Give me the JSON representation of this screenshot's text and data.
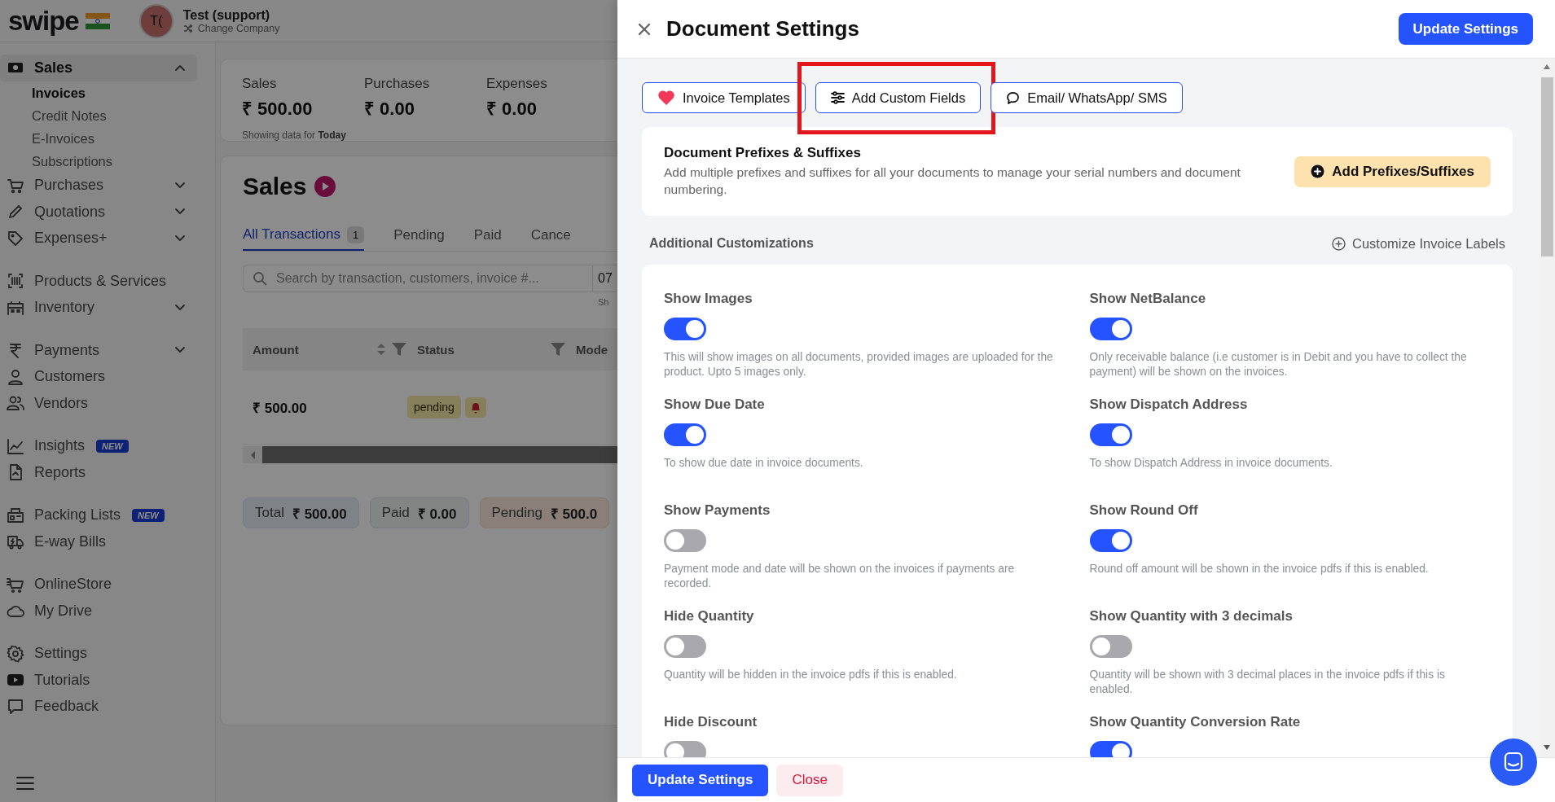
{
  "header": {
    "logo": "swipe",
    "avatar": "T(",
    "company": "Test (support)",
    "switch_label": "Change Company"
  },
  "sidebar": {
    "groups": [
      {
        "items": [
          {
            "label": "Sales",
            "expanded": true,
            "selected": true,
            "children": [
              {
                "label": "Invoices",
                "selected": true
              },
              {
                "label": "Credit Notes",
                "selected": false
              },
              {
                "label": "E-Invoices",
                "selected": false
              },
              {
                "label": "Subscriptions",
                "selected": false
              }
            ]
          },
          {
            "label": "Purchases",
            "expanded": false,
            "selected": false
          },
          {
            "label": "Quotations",
            "expanded": false,
            "selected": false
          },
          {
            "label": "Expenses+",
            "expanded": false,
            "selected": false
          }
        ]
      },
      {
        "items": [
          {
            "label": "Products & Services",
            "selected": false
          },
          {
            "label": "Inventory",
            "expanded": false,
            "selected": false
          }
        ]
      },
      {
        "items": [
          {
            "label": "Payments",
            "expanded": false,
            "selected": false
          },
          {
            "label": "Customers",
            "selected": false
          },
          {
            "label": "Vendors",
            "selected": false
          }
        ]
      },
      {
        "items": [
          {
            "label": "Insights",
            "badge": "NEW",
            "selected": false
          },
          {
            "label": "Reports",
            "selected": false
          }
        ]
      },
      {
        "items": [
          {
            "label": "Packing Lists",
            "badge": "NEW",
            "selected": false
          },
          {
            "label": "E-way Bills",
            "selected": false
          }
        ]
      },
      {
        "items": [
          {
            "label": "OnlineStore",
            "selected": false
          },
          {
            "label": "My Drive",
            "selected": false
          }
        ]
      },
      {
        "items": [
          {
            "label": "Settings",
            "selected": false
          },
          {
            "label": "Tutorials",
            "selected": false
          },
          {
            "label": "Feedback",
            "selected": false
          }
        ]
      }
    ]
  },
  "stats": {
    "items": [
      {
        "label": "Sales",
        "value": "₹ 500.00"
      },
      {
        "label": "Purchases",
        "value": "₹ 0.00"
      },
      {
        "label": "Expenses",
        "value": "₹ 0.00"
      }
    ],
    "note": "Showing data for **Today**"
  },
  "sales": {
    "title": "Sales",
    "tabs": [
      {
        "label": "All Transactions",
        "count": "1",
        "selected": true
      },
      {
        "label": "Pending",
        "selected": false
      },
      {
        "label": "Paid",
        "selected": false
      },
      {
        "label": "Cance",
        "selected": false
      }
    ],
    "search": {
      "placeholder": "Search by transaction, customers, invoice #..."
    },
    "date_field": {
      "value": "07"
    },
    "date_note": "Sh",
    "table": {
      "columns": [
        {
          "label": "Amount",
          "sortable": true,
          "filterable": true
        },
        {
          "label": "Status",
          "filterable": true
        },
        {
          "label": "Mode"
        }
      ],
      "rows": [
        {
          "amount": "₹ 500.00",
          "status": "pending"
        }
      ]
    },
    "totals": [
      {
        "label": "Total",
        "value": "₹ 500.00",
        "kind": "total"
      },
      {
        "label": "Paid",
        "value": "₹ 0.00",
        "kind": "paid"
      },
      {
        "label": "Pending",
        "value": "₹ 500.0",
        "kind": "pending"
      }
    ]
  },
  "drawer": {
    "title": "Document Settings",
    "primary_action": "Update Settings",
    "tabs": [
      {
        "label": "Invoice Templates",
        "kind": "templates"
      },
      {
        "label": "Add Custom Fields",
        "kind": "fields",
        "highlighted": true
      },
      {
        "label": "Email/ WhatsApp/ SMS",
        "kind": "messages"
      }
    ],
    "prefixes": {
      "title": "Document Prefixes & Suffixes",
      "description": "Add multiple prefixes and suffixes for all your documents to manage your serial numbers and document numbering.",
      "action": "Add Prefixes/Suffixes"
    },
    "section": {
      "title": "Additional Customizations",
      "link": "Customize Invoice Labels"
    },
    "settings": [
      {
        "label": "Show Images",
        "on": true,
        "description": "This will show images on all documents, provided images are uploaded for the product. Upto 5 images only."
      },
      {
        "label": "Show NetBalance",
        "on": true,
        "description": "Only receivable balance (i.e customer is in Debit and you have to collect the payment) will be shown on the invoices."
      },
      {
        "label": "Show Due Date",
        "on": true,
        "description": "To show due date in invoice documents."
      },
      {
        "label": "Show Dispatch Address",
        "on": true,
        "description": "To show Dispatch Address in invoice documents."
      },
      {
        "label": "Show Payments",
        "on": false,
        "description": "Payment mode and date will be shown on the invoices if payments are recorded."
      },
      {
        "label": "Show Round Off",
        "on": true,
        "description": "Round off amount will be shown in the invoice pdfs if this is enabled."
      },
      {
        "label": "Hide Quantity",
        "on": false,
        "description": "Quantity will be hidden in the invoice pdfs if this is enabled."
      },
      {
        "label": "Show Quantity with 3 decimals",
        "on": false,
        "description": "Quantity will be shown with 3 decimal places in the invoice pdfs if this is enabled."
      },
      {
        "label": "Hide Discount",
        "on": false
      },
      {
        "label": "Show Quantity Conversion Rate",
        "on": true
      }
    ],
    "footer": {
      "primary": "Update Settings",
      "secondary": "Close"
    }
  }
}
